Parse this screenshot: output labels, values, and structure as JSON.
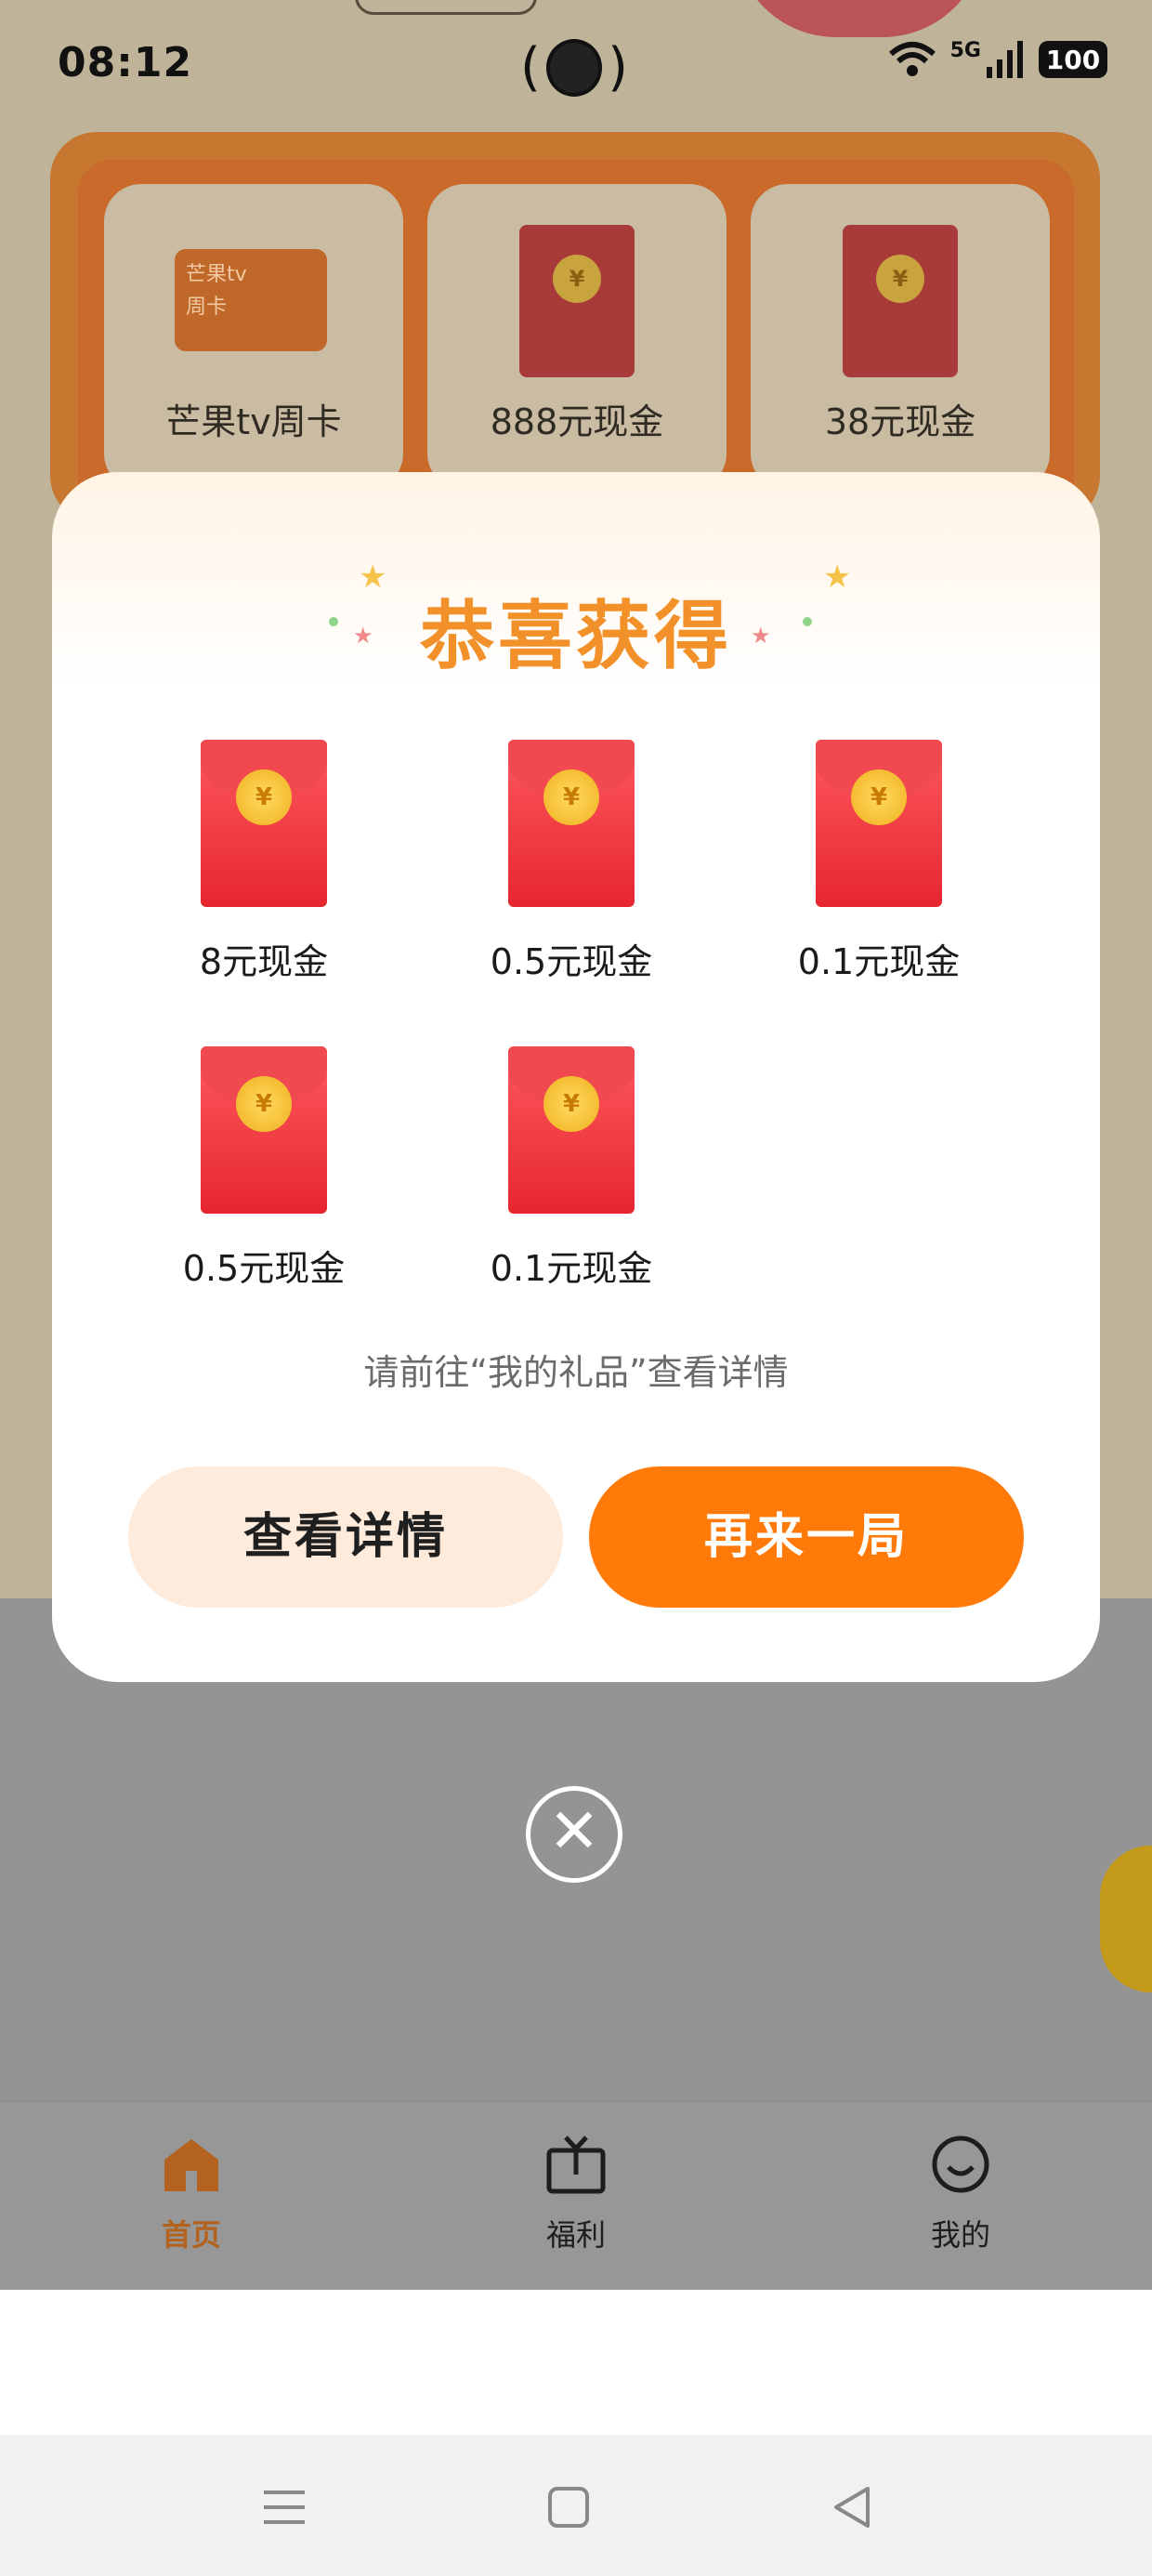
{
  "status_bar": {
    "time": "08:12",
    "network": "5G",
    "battery": "100",
    "icons": [
      "wifi-icon",
      "signal-icon",
      "battery-icon"
    ]
  },
  "prize_board": {
    "cards": [
      {
        "label": "芒果tv周卡",
        "icon": "mango-tv-card-icon",
        "card_brand": "芒果tv",
        "card_sub": "周卡"
      },
      {
        "label": "888元现金",
        "icon": "red-envelope-icon"
      },
      {
        "label": "38元现金",
        "icon": "red-envelope-icon"
      }
    ]
  },
  "modal": {
    "title": "恭喜获得",
    "rewards": [
      {
        "label": "8元现金"
      },
      {
        "label": "0.5元现金"
      },
      {
        "label": "0.1元现金"
      },
      {
        "label": "0.5元现金"
      },
      {
        "label": "0.1元现金"
      }
    ],
    "currency_symbol": "¥",
    "hint": "请前往“我的礼品”查看详情",
    "detail_button": "查看详情",
    "again_button": "再来一局"
  },
  "tabbar": {
    "items": [
      {
        "label": "首页",
        "icon": "home-icon",
        "active": true
      },
      {
        "label": "福利",
        "icon": "tv-icon",
        "active": false
      },
      {
        "label": "我的",
        "icon": "smiley-icon",
        "active": false
      }
    ]
  },
  "colors": {
    "accent": "#ff7a08",
    "title": "#f2902a",
    "active_tab": "#b3621f"
  }
}
